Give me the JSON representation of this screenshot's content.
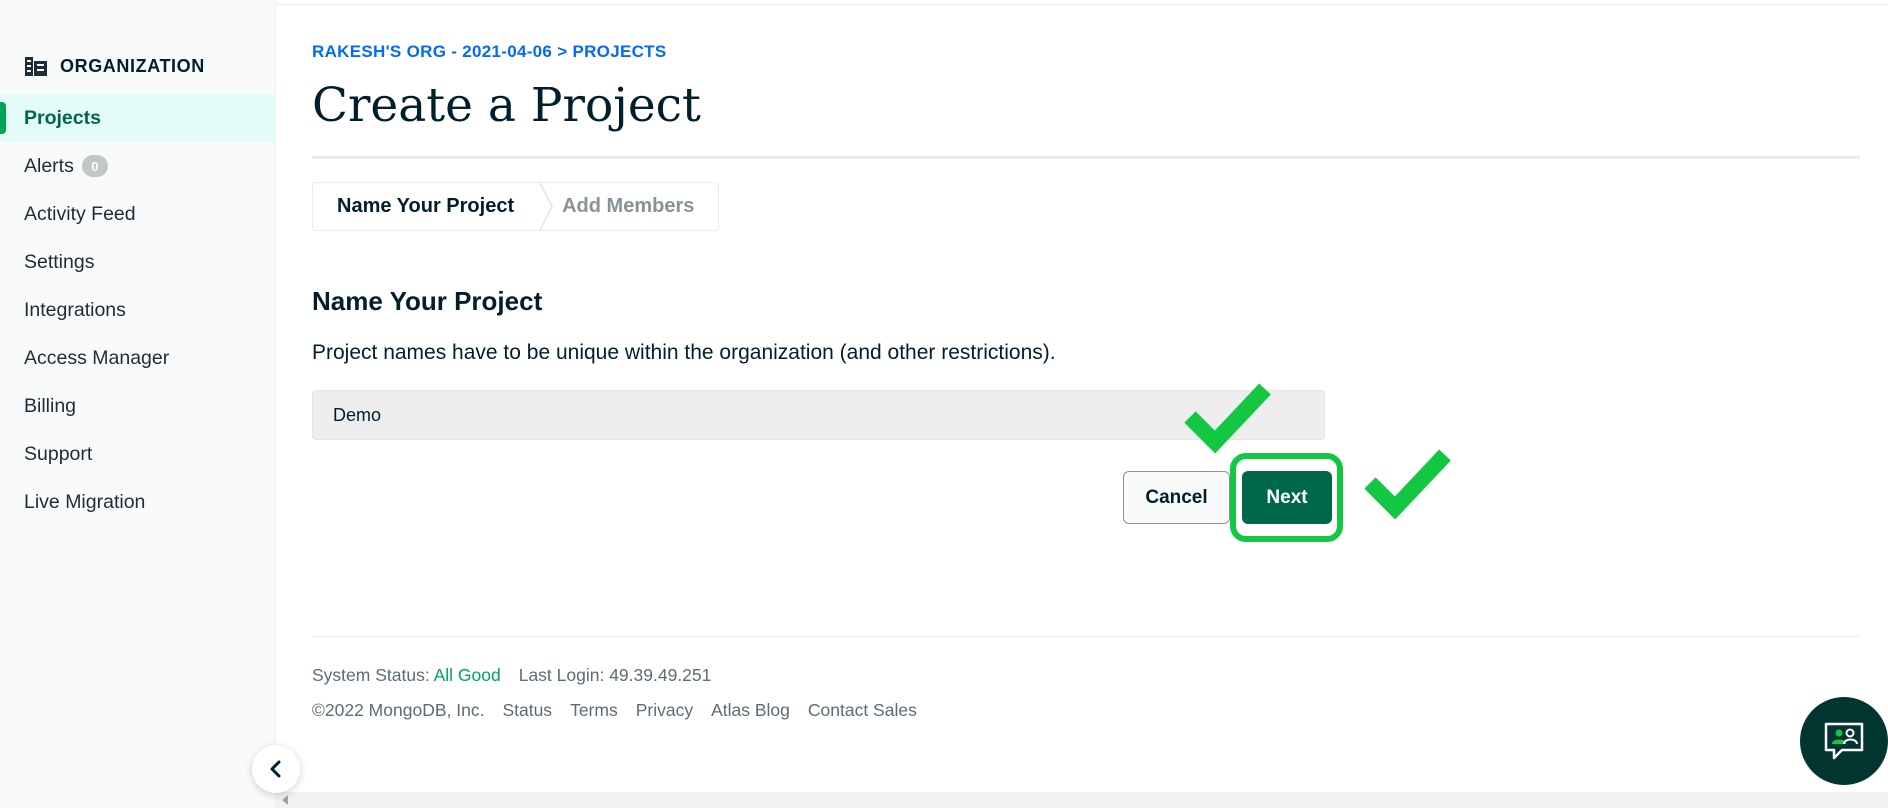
{
  "sidebar": {
    "header_label": "ORGANIZATION",
    "header_icon": "building-icon",
    "items": [
      {
        "label": "Projects",
        "active": true
      },
      {
        "label": "Alerts",
        "badge": "0"
      },
      {
        "label": "Activity Feed"
      },
      {
        "label": "Settings"
      },
      {
        "label": "Integrations"
      },
      {
        "label": "Access Manager"
      },
      {
        "label": "Billing"
      },
      {
        "label": "Support"
      },
      {
        "label": "Live Migration"
      }
    ],
    "collapse_icon": "chevron-left-icon"
  },
  "main": {
    "breadcrumb": "RAKESH'S ORG - 2021-04-06 > PROJECTS",
    "title": "Create a Project",
    "wizard": {
      "steps": [
        {
          "label": "Name Your Project",
          "active": true
        },
        {
          "label": "Add Members",
          "active": false
        }
      ]
    },
    "section_title": "Name Your Project",
    "section_desc": "Project names have to be unique within the organization (and other restrictions).",
    "project_name_value": "Demo",
    "cancel_label": "Cancel",
    "next_label": "Next",
    "annotation_icon": "checkmark-icon"
  },
  "footer": {
    "system_status_label": "System Status:",
    "system_status_value": "All Good",
    "last_login": "Last Login: 49.39.49.251",
    "copyright": "©2022 MongoDB, Inc.",
    "links": [
      "Status",
      "Terms",
      "Privacy",
      "Atlas Blog",
      "Contact Sales"
    ]
  },
  "chat_icon": "chat-support-icon",
  "colors": {
    "accent_green": "#00684a",
    "highlight_green": "#13c742",
    "link_blue": "#016bf8",
    "status_green": "#00a35c"
  }
}
